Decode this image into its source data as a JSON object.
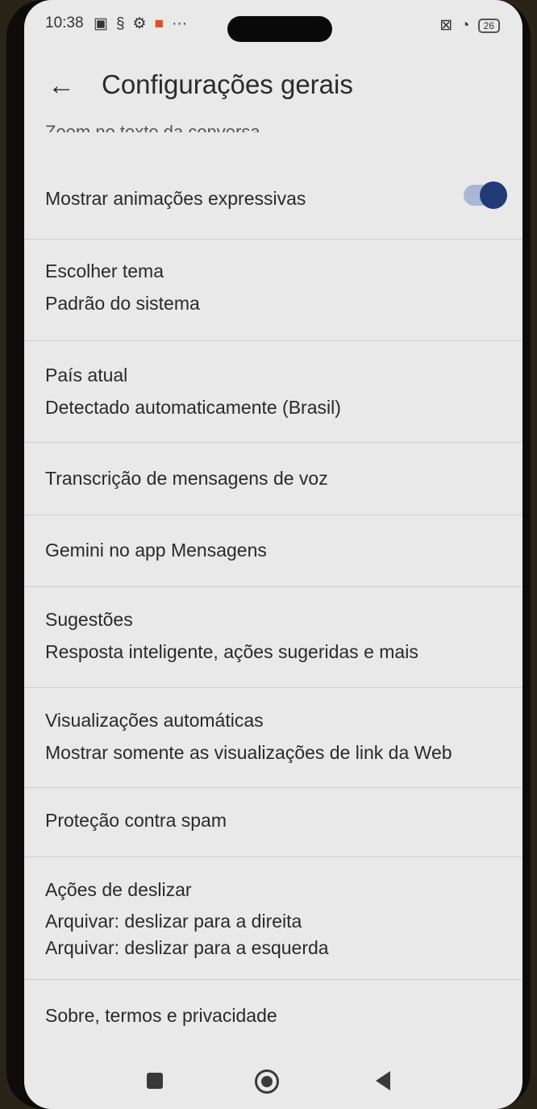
{
  "status_bar": {
    "time": "10:38",
    "battery": "26"
  },
  "header": {
    "title": "Configurações gerais"
  },
  "clipped_item": "Zoom no texto da conversa",
  "items": [
    {
      "line1": "Mostrar animações expressivas",
      "toggle_on": true
    },
    {
      "line1": "Escolher tema",
      "line2": "Padrão do sistema"
    },
    {
      "line1": "País atual",
      "line2": "Detectado automaticamente (Brasil)"
    },
    {
      "line1": "Transcrição de mensagens de voz"
    },
    {
      "line1": "Gemini no app Mensagens"
    },
    {
      "line1": "Sugestões",
      "line2": "Resposta inteligente, ações sugeridas e mais"
    },
    {
      "line1": "Visualizações automáticas",
      "line2": "Mostrar somente as visualizações de link da Web"
    },
    {
      "line1": "Proteção contra spam"
    },
    {
      "line1": "Ações de deslizar",
      "line2": "Arquivar: deslizar para a direita",
      "line3": "Arquivar: deslizar para a esquerda"
    },
    {
      "line1": "Sobre, termos e privacidade"
    }
  ],
  "icons": {
    "back": "arrow-left-icon",
    "nav_recents": "square-icon",
    "nav_home": "circle-icon",
    "nav_back": "triangle-left-icon"
  },
  "colors": {
    "toggle_knob": "#233a78",
    "toggle_track": "#a9b6d6",
    "background": "#e9e9ea"
  }
}
